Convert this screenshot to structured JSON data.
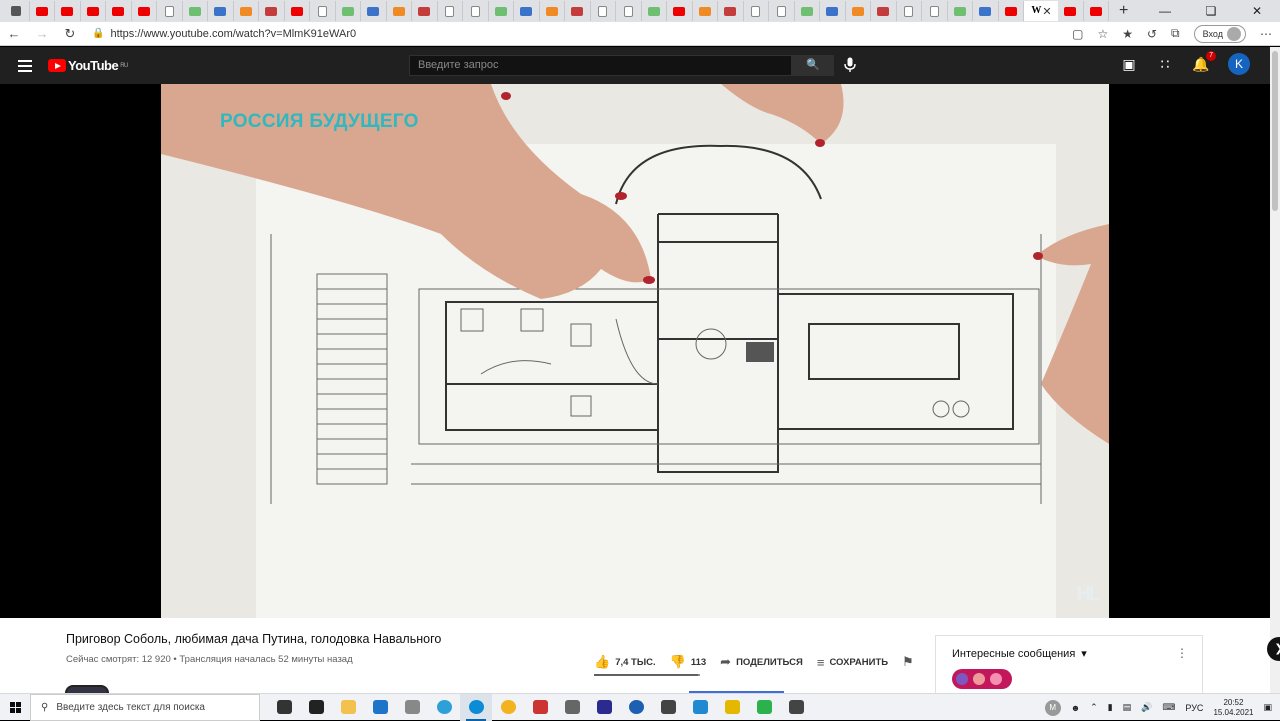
{
  "browser": {
    "tabs": [
      {
        "icon": "square-icon",
        "color": "#555"
      },
      {
        "icon": "youtube-icon"
      },
      {
        "icon": "youtube-icon"
      },
      {
        "icon": "youtube-icon"
      },
      {
        "icon": "youtube-icon"
      },
      {
        "icon": "youtube-icon"
      },
      {
        "icon": "page-icon"
      },
      {
        "icon": "page-icon"
      },
      {
        "icon": "page-icon"
      },
      {
        "icon": "page-icon"
      },
      {
        "icon": "page-icon"
      },
      {
        "icon": "youtube-icon"
      },
      {
        "icon": "page-icon"
      },
      {
        "icon": "page-icon"
      },
      {
        "icon": "page-icon"
      },
      {
        "icon": "page-icon"
      },
      {
        "icon": "page-icon"
      },
      {
        "icon": "page-icon"
      },
      {
        "icon": "page-icon"
      },
      {
        "icon": "page-icon"
      },
      {
        "icon": "page-icon"
      },
      {
        "icon": "page-icon"
      },
      {
        "icon": "page-icon"
      },
      {
        "icon": "page-icon"
      },
      {
        "icon": "page-icon"
      },
      {
        "icon": "page-icon"
      },
      {
        "icon": "youtube-icon"
      },
      {
        "icon": "page-icon"
      },
      {
        "icon": "page-icon"
      },
      {
        "icon": "page-icon"
      },
      {
        "icon": "page-icon"
      },
      {
        "icon": "page-icon"
      },
      {
        "icon": "page-icon"
      },
      {
        "icon": "page-icon"
      },
      {
        "icon": "page-icon"
      },
      {
        "icon": "page-icon"
      },
      {
        "icon": "page-icon"
      },
      {
        "icon": "page-icon"
      },
      {
        "icon": "page-icon"
      },
      {
        "icon": "youtube-icon"
      }
    ],
    "active_tab_icon_letter": "W",
    "url": "https://www.youtube.com/watch?v=MlmK91eWAr0",
    "signin_label": "Вход"
  },
  "youtube": {
    "logo_text": "YouTube",
    "region": "RU",
    "search_placeholder": "Введите запрос",
    "notification_count": "7",
    "avatar_letter": "K"
  },
  "video": {
    "overlay_title": "РОССИЯ БУДУЩЕГО",
    "corner_logo": "HL"
  },
  "watch": {
    "title": "Приговор Соболь, любимая дача Путина, голодовка Навального",
    "meta": "Сейчас смотрят: 12 920 • Трансляция началась 52 минуты назад",
    "likes": "7,4 ТЫС.",
    "dislikes": "113",
    "like_ratio": 0.985,
    "share_label": "ПОДЕЛИТЬСЯ",
    "save_label": "СОХРАНИТЬ"
  },
  "chat": {
    "header": "Интересные сообщения"
  },
  "taskbar": {
    "search_placeholder": "Введите здесь текст для поиска",
    "language": "РУС",
    "time": "20:52",
    "date": "15.04.2021",
    "user_initial": "M",
    "apps": [
      {
        "name": "task-view",
        "color": "#333"
      },
      {
        "name": "store",
        "color": "#222"
      },
      {
        "name": "explorer",
        "color": "#f2c14e"
      },
      {
        "name": "mail",
        "color": "#1e74c9"
      },
      {
        "name": "settings",
        "color": "#888"
      },
      {
        "name": "telegram",
        "color": "#2ea0d8"
      },
      {
        "name": "edge",
        "color": "#0c8bd6"
      },
      {
        "name": "yandex",
        "color": "#f3b31e"
      },
      {
        "name": "chart",
        "color": "#c33"
      },
      {
        "name": "puzzle",
        "color": "#666"
      },
      {
        "name": "jetbrains",
        "color": "#2b2b8f"
      },
      {
        "name": "globe",
        "color": "#1d5fb0"
      },
      {
        "name": "terminal",
        "color": "#444"
      },
      {
        "name": "vscode",
        "color": "#1f8ad2"
      },
      {
        "name": "arc",
        "color": "#e5b800"
      },
      {
        "name": "money",
        "color": "#2bb24c"
      },
      {
        "name": "close-app",
        "color": "#444"
      }
    ]
  }
}
